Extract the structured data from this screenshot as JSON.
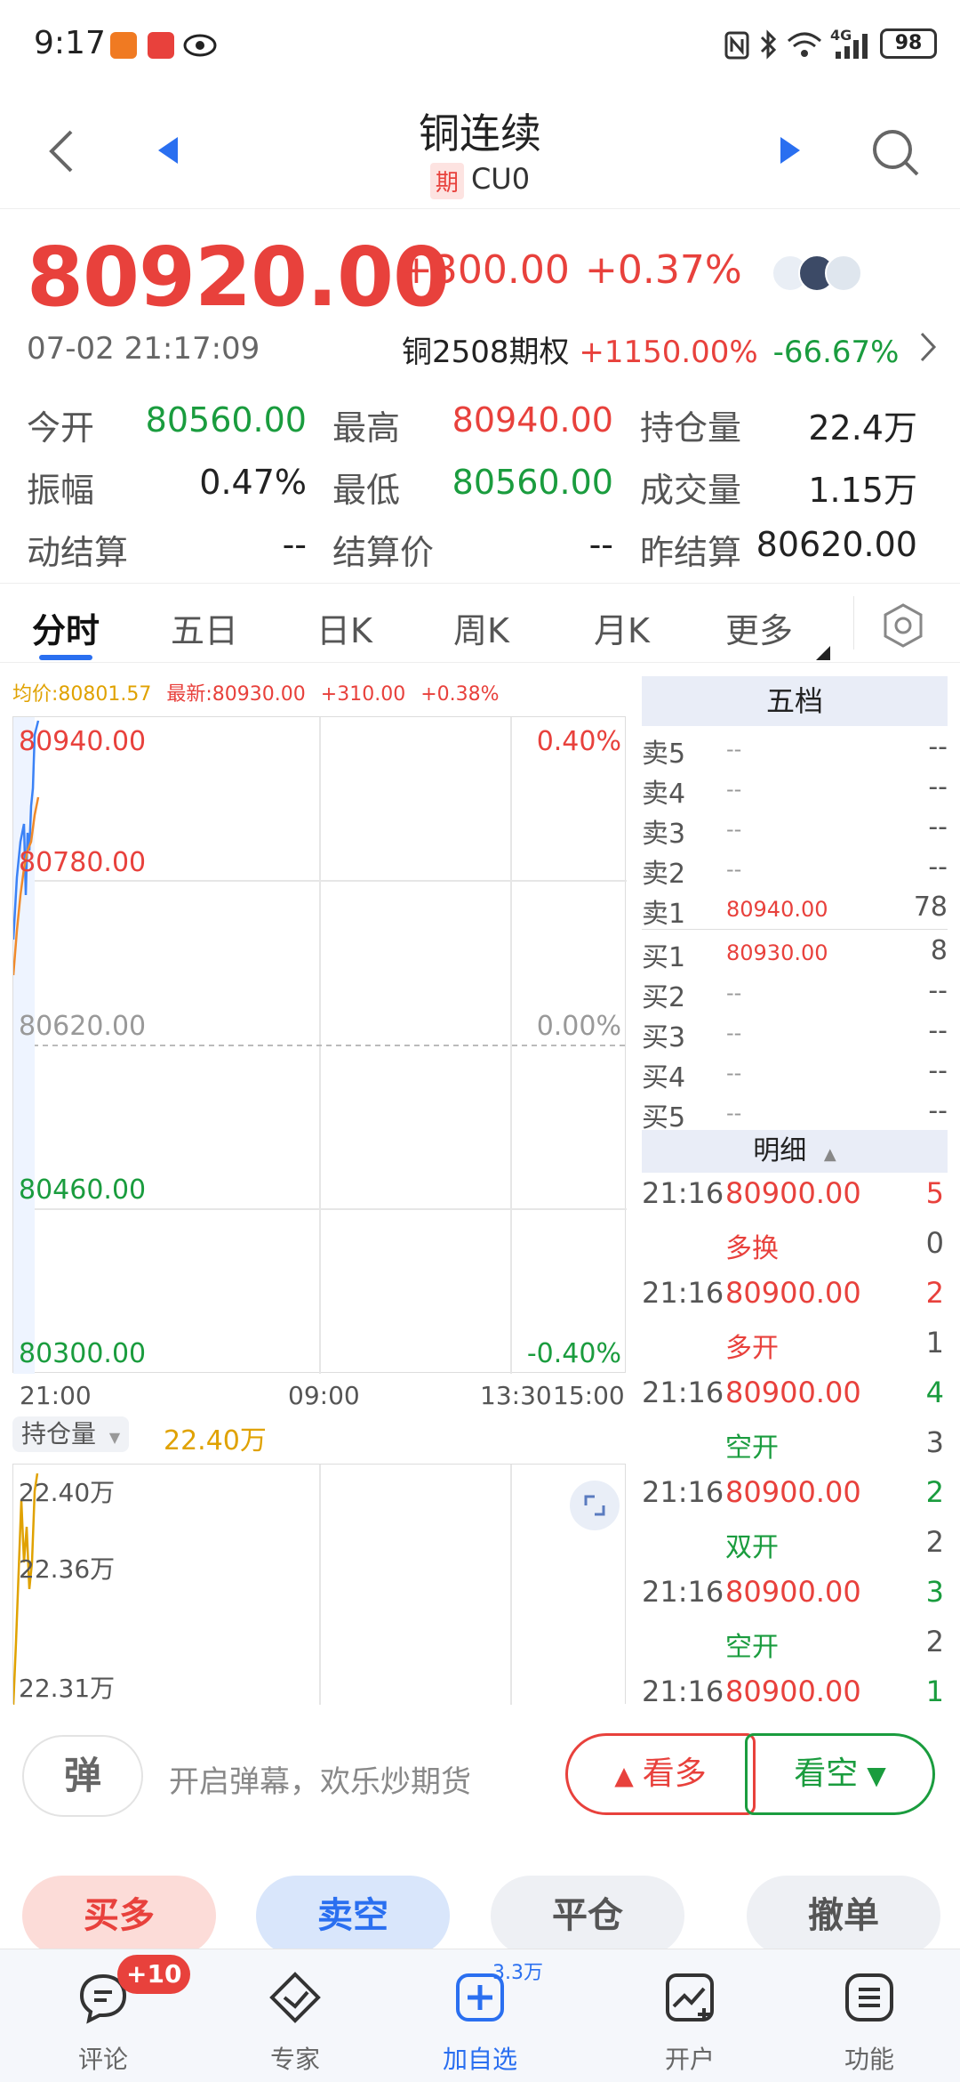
{
  "status_bar": {
    "time": "9:17",
    "battery": "98",
    "network": "4G"
  },
  "header": {
    "title": "铜连续",
    "badge": "期",
    "code": "CU0"
  },
  "quote": {
    "price": "80920.00",
    "change": "+300.00",
    "change_pct": "+0.37%",
    "timestamp": "07-02 21:17:09",
    "option_name": "铜2508期权",
    "option_up": "+1150.00%",
    "option_down": "-66.67%"
  },
  "stats": [
    {
      "label": "今开",
      "value": "80560.00",
      "color": "green"
    },
    {
      "label": "最高",
      "value": "80940.00",
      "color": "red"
    },
    {
      "label": "持仓量",
      "value": "22.4万",
      "color": "dark"
    },
    {
      "label": "振幅",
      "value": "0.47%",
      "color": "dark"
    },
    {
      "label": "最低",
      "value": "80560.00",
      "color": "green"
    },
    {
      "label": "成交量",
      "value": "1.15万",
      "color": "dark"
    },
    {
      "label": "动结算",
      "value": "--",
      "color": "dark"
    },
    {
      "label": "结算价",
      "value": "--",
      "color": "dark"
    },
    {
      "label": "昨结算",
      "value": "80620.00",
      "color": "dark"
    }
  ],
  "tabs": [
    "分时",
    "五日",
    "日K",
    "周K",
    "月K",
    "更多"
  ],
  "chart": {
    "avg_label": "均价:80801.57",
    "latest_label": "最新:80930.00",
    "latest_change": "+310.00",
    "latest_pct": "+0.38%",
    "y_left": [
      "80940.00",
      "80780.00",
      "80620.00",
      "80460.00",
      "80300.00"
    ],
    "y_right_top": "0.40%",
    "y_right_mid": "0.00%",
    "y_right_bottom": "-0.40%",
    "x_labels": [
      "21:00",
      "09:00",
      "13:30",
      "15:00"
    ],
    "indicator_label": "持仓量",
    "indicator_value": "22.40万",
    "vol_labels": [
      "22.40万",
      "22.36万",
      "22.31万"
    ]
  },
  "five_levels": {
    "title": "五档",
    "sell": [
      {
        "n": "卖5",
        "p": "--",
        "v": "--"
      },
      {
        "n": "卖4",
        "p": "--",
        "v": "--"
      },
      {
        "n": "卖3",
        "p": "--",
        "v": "--"
      },
      {
        "n": "卖2",
        "p": "--",
        "v": "--"
      },
      {
        "n": "卖1",
        "p": "80940.00",
        "v": "78"
      }
    ],
    "buy": [
      {
        "n": "买1",
        "p": "80930.00",
        "v": "8"
      },
      {
        "n": "买2",
        "p": "--",
        "v": "--"
      },
      {
        "n": "买3",
        "p": "--",
        "v": "--"
      },
      {
        "n": "买4",
        "p": "--",
        "v": "--"
      },
      {
        "n": "买5",
        "p": "--",
        "v": "--"
      }
    ]
  },
  "detail": {
    "title": "明细",
    "ticks": [
      {
        "t": "21:16",
        "p": "80900.00",
        "v": "5",
        "type": "多换",
        "n": "0",
        "vcolor": "red",
        "tcolor": "red"
      },
      {
        "t": "21:16",
        "p": "80900.00",
        "v": "2",
        "type": "多开",
        "n": "1",
        "vcolor": "red",
        "tcolor": "red"
      },
      {
        "t": "21:16",
        "p": "80900.00",
        "v": "4",
        "type": "空开",
        "n": "3",
        "vcolor": "green",
        "tcolor": "green"
      },
      {
        "t": "21:16",
        "p": "80900.00",
        "v": "2",
        "type": "双开",
        "n": "2",
        "vcolor": "green",
        "tcolor": "green"
      },
      {
        "t": "21:16",
        "p": "80900.00",
        "v": "3",
        "type": "空开",
        "n": "2",
        "vcolor": "green",
        "tcolor": "green"
      },
      {
        "t": "21:16",
        "p": "80900.00",
        "v": "1",
        "type": "",
        "n": "",
        "vcolor": "green",
        "tcolor": "green"
      }
    ]
  },
  "danmu": {
    "icon_text": "弹",
    "placeholder": "开启弹幕，欢乐炒期货"
  },
  "sentiment": {
    "bull": "看多",
    "bear": "看空"
  },
  "trade": {
    "buy_long": "买多",
    "sell_short": "卖空",
    "close": "平仓",
    "cancel": "撤单"
  },
  "nav": {
    "items": [
      "评论",
      "专家",
      "加自选",
      "开户",
      "功能"
    ],
    "comment_badge": "+10",
    "watch_count": "3.3万"
  },
  "colors": {
    "red": "#e8413c",
    "green": "#1a9c3e",
    "blue": "#2a6ff0"
  }
}
